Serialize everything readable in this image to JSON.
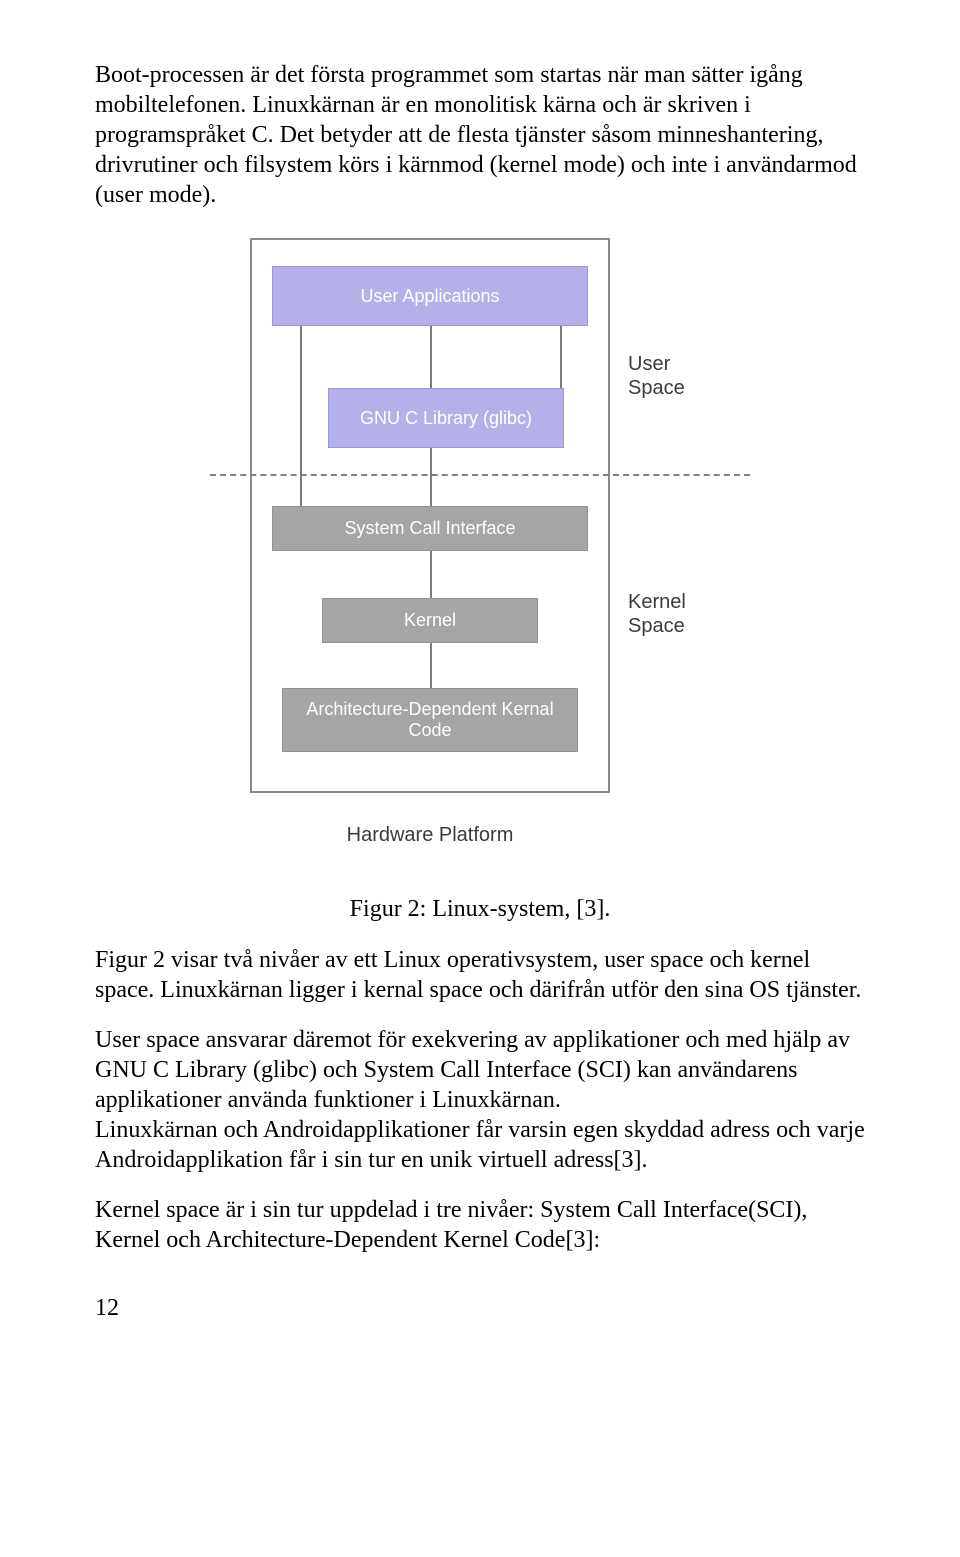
{
  "p1": "Boot-processen är det första programmet som startas när man sätter igång mobiltelefonen. Linuxkärnan är en monolitisk kärna och är skriven i programspråket C. Det betyder att de flesta tjänster såsom minneshantering, drivrutiner och filsystem körs i kärnmod (kernel mode) och inte i användarmod (user mode).",
  "fig": {
    "user_apps": "User Applications",
    "glibc": "GNU C Library (glibc)",
    "sci": "System Call Interface",
    "kernel": "Kernel",
    "arch_l1": "Architecture-Dependent Kernal",
    "arch_l2": "Code",
    "hw": "Hardware Platform",
    "user_space_l1": "User",
    "user_space_l2": "Space",
    "kernel_space_l1": "Kernel",
    "kernel_space_l2": "Space"
  },
  "caption": "Figur 2: Linux-system, [3].",
  "p2": "Figur 2 visar två nivåer av ett Linux operativsystem, user space och kernel space. Linuxkärnan ligger i kernal space och därifrån utför den sina OS tjänster.",
  "p3": "User space ansvarar däremot för exekvering av applikationer och med hjälp av GNU C Library (glibc) och System Call Interface (SCI) kan användarens applikationer använda funktioner i Linuxkärnan.",
  "p4": "Linuxkärnan och Androidapplikationer får varsin egen skyddad adress och varje Androidapplikation får i sin tur en unik virtuell adress[3].",
  "p5": "Kernel space är i sin tur uppdelad i tre nivåer: System Call Interface(SCI), Kernel och Architecture-Dependent Kernel Code[3]:",
  "page_number": "12",
  "chart_data": {
    "type": "diagram",
    "title": "Linux-system",
    "groups": [
      {
        "name": "User Space",
        "blocks": [
          "User Applications",
          "GNU C Library (glibc)"
        ]
      },
      {
        "name": "Kernel Space",
        "blocks": [
          "System Call Interface",
          "Kernel",
          "Architecture-Dependent Kernal Code"
        ]
      }
    ],
    "footer": "Hardware Platform",
    "connections": [
      [
        "User Applications",
        "GNU C Library (glibc)"
      ],
      [
        "User Applications",
        "System Call Interface"
      ],
      [
        "GNU C Library (glibc)",
        "System Call Interface"
      ],
      [
        "System Call Interface",
        "Kernel"
      ],
      [
        "Kernel",
        "Architecture-Dependent Kernal Code"
      ]
    ]
  }
}
